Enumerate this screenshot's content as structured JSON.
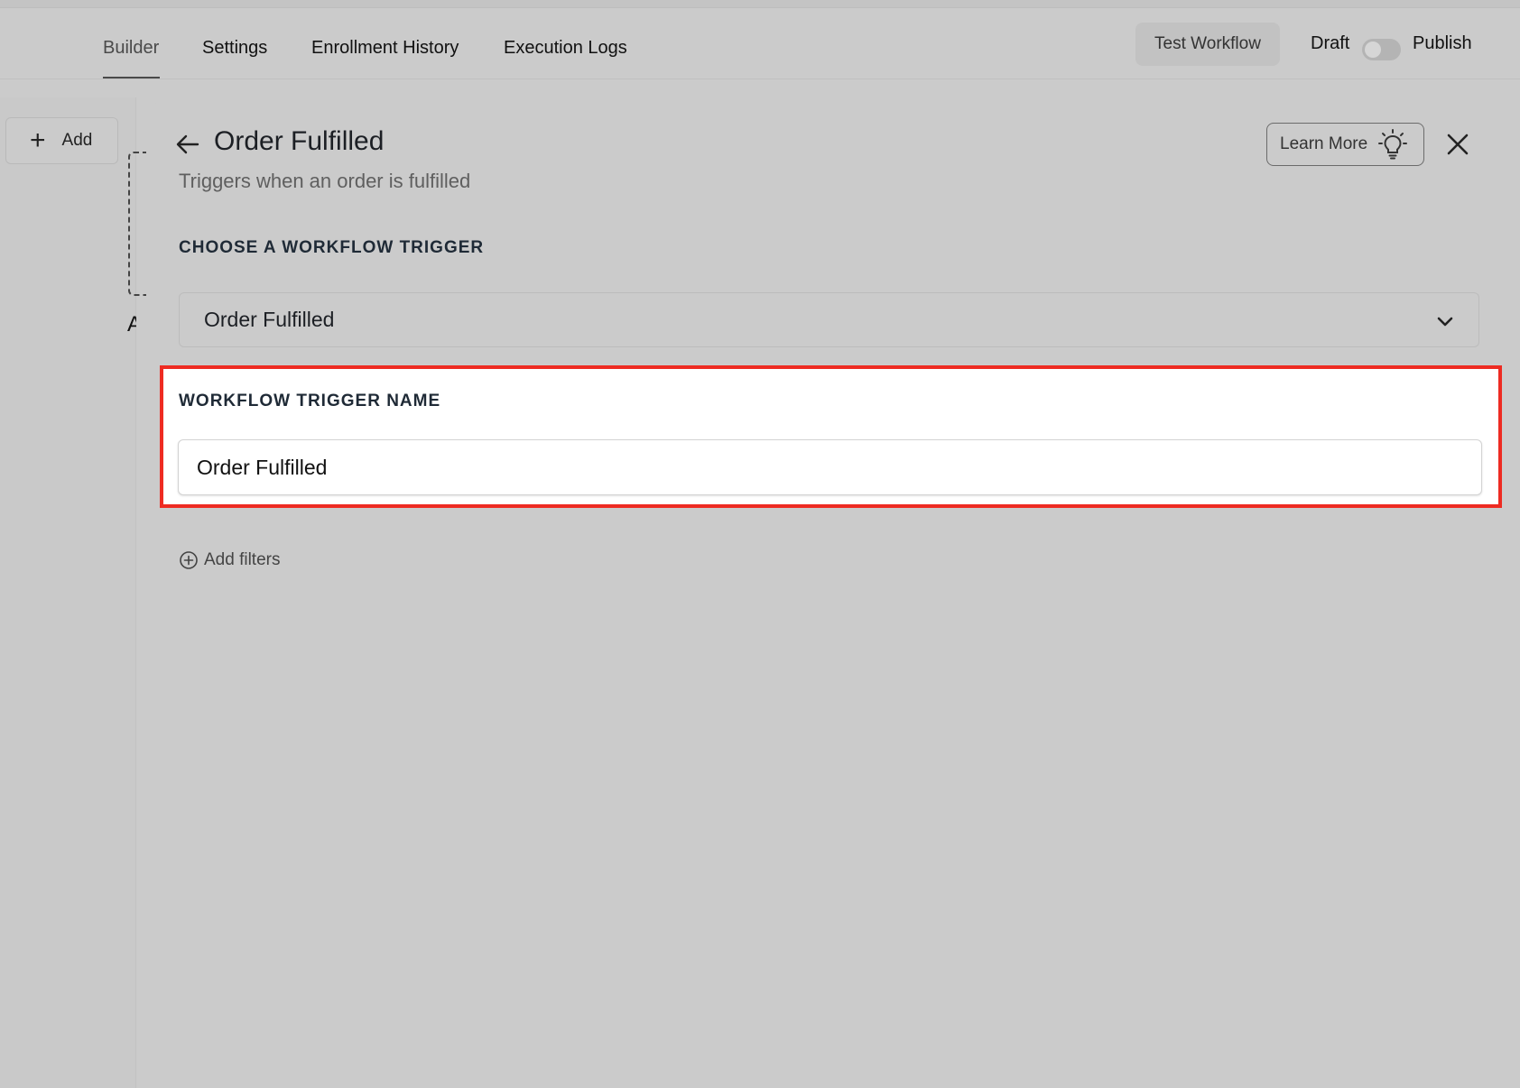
{
  "nav": {
    "tabs": [
      {
        "label": "Builder"
      },
      {
        "label": "Settings"
      },
      {
        "label": "Enrollment History"
      },
      {
        "label": "Execution Logs"
      }
    ],
    "test_workflow_label": "Test Workflow",
    "draft_label": "Draft",
    "publish_label": "Publish"
  },
  "canvas": {
    "add_label": "Add",
    "cut_text": "A"
  },
  "panel": {
    "title": "Order Fulfilled",
    "subtitle": "Triggers when an order is fulfilled",
    "learn_more_label": "Learn More",
    "trigger_section_label": "CHOOSE A WORKFLOW TRIGGER",
    "trigger_selected": "Order Fulfilled",
    "name_section_label": "WORKFLOW TRIGGER NAME",
    "name_value": "Order Fulfilled",
    "add_filters_label": "Add filters"
  },
  "colors": {
    "highlight_border": "#ee2b22",
    "background": "#cbcbcb"
  }
}
